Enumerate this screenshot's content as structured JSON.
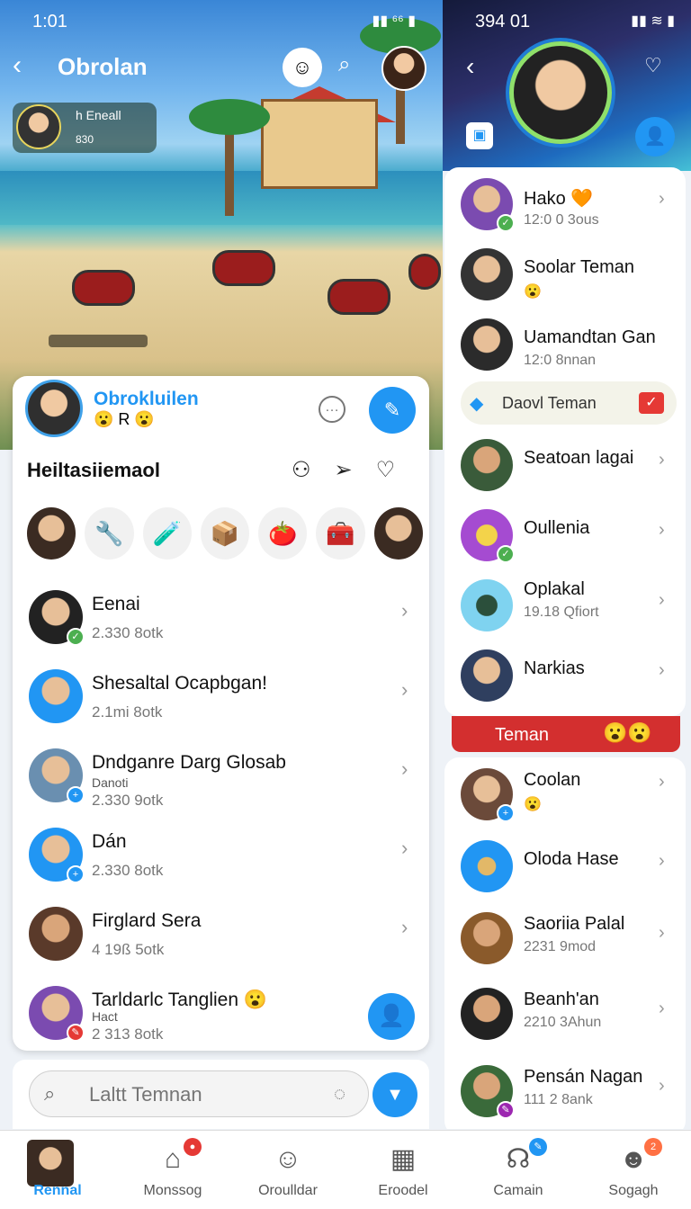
{
  "left": {
    "status": {
      "time": "1:01",
      "icons": "▮▮ ⁶⁶ ▮"
    },
    "header": {
      "title": "Obrolan"
    },
    "hud": {
      "player_name": "h Eneall",
      "score": "830"
    },
    "chat_card": {
      "head_name": "Obrokluilen",
      "head_emojis": "😮 R 😮",
      "section_title": "Heiltasiiemaol",
      "stories": [
        "",
        "🔧",
        "🧪",
        "📦",
        "🍅",
        "🧰",
        ""
      ],
      "rows": [
        {
          "name": "Eenai",
          "sub": "",
          "meta": "2.330 8otk",
          "badge_color": "#4caf50"
        },
        {
          "name": "Shesaltal Ocapbgan!",
          "sub": "",
          "meta": "2.1mi 8otk",
          "badge_color": ""
        },
        {
          "name": "Dndganre Darg Glosab",
          "sub": "Danoti",
          "meta": "2.330 9otk",
          "badge_color": "#2196f3"
        },
        {
          "name": "Dán",
          "sub": "",
          "meta": "2.330 8otk",
          "badge_color": "#2196f3"
        },
        {
          "name": "Firglard Sera",
          "sub": "",
          "meta": "4 19ß 5otk",
          "badge_color": ""
        },
        {
          "name": "Tarldarlc Tanglien 😮",
          "sub": "Hact",
          "meta": "2 313 8otk",
          "badge_color": "#e53935"
        }
      ]
    },
    "search": {
      "placeholder": "Laltt Temnan"
    }
  },
  "right": {
    "status": {
      "time": "394 01",
      "icons": "▮▮ ≋ ▮"
    },
    "top_friends": [
      {
        "name": "Hako 🧡",
        "meta": "12:0 0 3ous",
        "badge_color": "#4caf50"
      },
      {
        "name": "Soolar Teman",
        "meta": "😮",
        "badge_color": ""
      },
      {
        "name": "Uamandtan Gan",
        "meta": "12:0 8nnan",
        "badge_color": ""
      }
    ],
    "group_label": "Daovl Teman",
    "mid_friends": [
      {
        "name": "Seatoan lagai",
        "meta": "",
        "badge_color": ""
      },
      {
        "name": "Oullenia",
        "meta": "",
        "badge_color": "#4caf50"
      },
      {
        "name": "Oplakal",
        "meta": "19.18 Qfiort",
        "badge_color": ""
      },
      {
        "name": "Narkias",
        "meta": "",
        "badge_color": ""
      }
    ],
    "teman_bar": {
      "label": "Teman",
      "emojis": "😮😮"
    },
    "bottom_friends": [
      {
        "name": "Coolan",
        "meta": "😮",
        "badge_color": "#2196f3"
      },
      {
        "name": "Oloda Hase",
        "meta": "",
        "badge_color": ""
      },
      {
        "name": "Saoriia Palal",
        "meta": "2231 9mod",
        "badge_color": ""
      },
      {
        "name": "Beanh'an",
        "meta": "2210 3Ahun",
        "badge_color": ""
      },
      {
        "name": "Pensán Nagan",
        "meta": "111 2 8ank",
        "badge_color": "#9c27b0"
      }
    ]
  },
  "bottom_nav": [
    {
      "label": "Rennal",
      "icon": "avatar",
      "active": true,
      "badge": ""
    },
    {
      "label": "Monssog",
      "icon": "home-icon",
      "active": false,
      "badge": "●"
    },
    {
      "label": "Oroulldar",
      "icon": "person-icon",
      "active": false,
      "badge": ""
    },
    {
      "label": "Eroodel",
      "icon": "grid-icon",
      "active": false,
      "badge": ""
    },
    {
      "label": "Camain",
      "icon": "headset-icon",
      "active": false,
      "badge": "✎"
    },
    {
      "label": "Sogagh",
      "icon": "bot-icon",
      "active": false,
      "badge": "2"
    }
  ],
  "colors": {
    "accent": "#2196f3",
    "danger": "#d32f2f",
    "online": "#4caf50"
  }
}
